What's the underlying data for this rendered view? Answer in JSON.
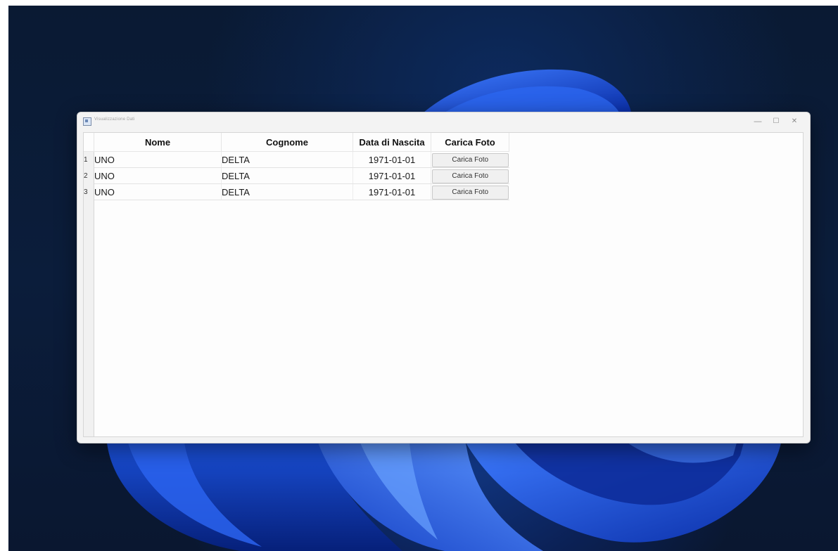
{
  "window": {
    "title": "Visualizzazione Dati",
    "controls": {
      "minimize": "—",
      "maximize": "☐",
      "close": "✕"
    }
  },
  "table": {
    "columns": [
      "Nome",
      "Cognome",
      "Data di Nascita",
      "Carica Foto"
    ],
    "rows": [
      {
        "num": "1",
        "nome": "UNO",
        "cognome": "DELTA",
        "data": "1971-01-01",
        "button": "Carica Foto"
      },
      {
        "num": "2",
        "nome": "UNO",
        "cognome": "DELTA",
        "data": "1971-01-01",
        "button": "Carica Foto"
      },
      {
        "num": "3",
        "nome": "UNO",
        "cognome": "DELTA",
        "data": "1971-01-01",
        "button": "Carica Foto"
      }
    ]
  },
  "colors": {
    "wallpaper_bloom": "#1f5be0",
    "wallpaper_bg": "#0a1a33",
    "window_bg": "#f3f3f3"
  }
}
